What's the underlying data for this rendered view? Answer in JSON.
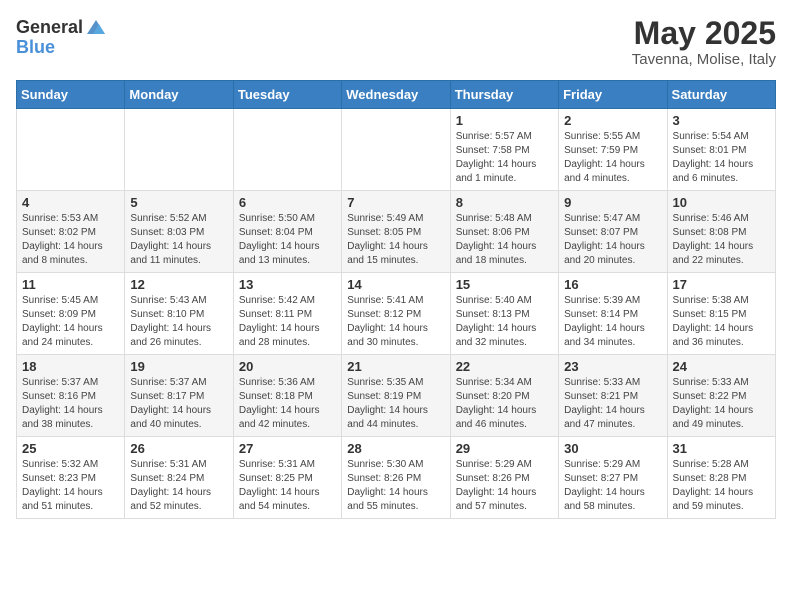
{
  "logo": {
    "general": "General",
    "blue": "Blue"
  },
  "title": "May 2025",
  "subtitle": "Tavenna, Molise, Italy",
  "days_of_week": [
    "Sunday",
    "Monday",
    "Tuesday",
    "Wednesday",
    "Thursday",
    "Friday",
    "Saturday"
  ],
  "weeks": [
    [
      {
        "day": "",
        "info": ""
      },
      {
        "day": "",
        "info": ""
      },
      {
        "day": "",
        "info": ""
      },
      {
        "day": "",
        "info": ""
      },
      {
        "day": "1",
        "info": "Sunrise: 5:57 AM\nSunset: 7:58 PM\nDaylight: 14 hours and 1 minute."
      },
      {
        "day": "2",
        "info": "Sunrise: 5:55 AM\nSunset: 7:59 PM\nDaylight: 14 hours and 4 minutes."
      },
      {
        "day": "3",
        "info": "Sunrise: 5:54 AM\nSunset: 8:01 PM\nDaylight: 14 hours and 6 minutes."
      }
    ],
    [
      {
        "day": "4",
        "info": "Sunrise: 5:53 AM\nSunset: 8:02 PM\nDaylight: 14 hours and 8 minutes."
      },
      {
        "day": "5",
        "info": "Sunrise: 5:52 AM\nSunset: 8:03 PM\nDaylight: 14 hours and 11 minutes."
      },
      {
        "day": "6",
        "info": "Sunrise: 5:50 AM\nSunset: 8:04 PM\nDaylight: 14 hours and 13 minutes."
      },
      {
        "day": "7",
        "info": "Sunrise: 5:49 AM\nSunset: 8:05 PM\nDaylight: 14 hours and 15 minutes."
      },
      {
        "day": "8",
        "info": "Sunrise: 5:48 AM\nSunset: 8:06 PM\nDaylight: 14 hours and 18 minutes."
      },
      {
        "day": "9",
        "info": "Sunrise: 5:47 AM\nSunset: 8:07 PM\nDaylight: 14 hours and 20 minutes."
      },
      {
        "day": "10",
        "info": "Sunrise: 5:46 AM\nSunset: 8:08 PM\nDaylight: 14 hours and 22 minutes."
      }
    ],
    [
      {
        "day": "11",
        "info": "Sunrise: 5:45 AM\nSunset: 8:09 PM\nDaylight: 14 hours and 24 minutes."
      },
      {
        "day": "12",
        "info": "Sunrise: 5:43 AM\nSunset: 8:10 PM\nDaylight: 14 hours and 26 minutes."
      },
      {
        "day": "13",
        "info": "Sunrise: 5:42 AM\nSunset: 8:11 PM\nDaylight: 14 hours and 28 minutes."
      },
      {
        "day": "14",
        "info": "Sunrise: 5:41 AM\nSunset: 8:12 PM\nDaylight: 14 hours and 30 minutes."
      },
      {
        "day": "15",
        "info": "Sunrise: 5:40 AM\nSunset: 8:13 PM\nDaylight: 14 hours and 32 minutes."
      },
      {
        "day": "16",
        "info": "Sunrise: 5:39 AM\nSunset: 8:14 PM\nDaylight: 14 hours and 34 minutes."
      },
      {
        "day": "17",
        "info": "Sunrise: 5:38 AM\nSunset: 8:15 PM\nDaylight: 14 hours and 36 minutes."
      }
    ],
    [
      {
        "day": "18",
        "info": "Sunrise: 5:37 AM\nSunset: 8:16 PM\nDaylight: 14 hours and 38 minutes."
      },
      {
        "day": "19",
        "info": "Sunrise: 5:37 AM\nSunset: 8:17 PM\nDaylight: 14 hours and 40 minutes."
      },
      {
        "day": "20",
        "info": "Sunrise: 5:36 AM\nSunset: 8:18 PM\nDaylight: 14 hours and 42 minutes."
      },
      {
        "day": "21",
        "info": "Sunrise: 5:35 AM\nSunset: 8:19 PM\nDaylight: 14 hours and 44 minutes."
      },
      {
        "day": "22",
        "info": "Sunrise: 5:34 AM\nSunset: 8:20 PM\nDaylight: 14 hours and 46 minutes."
      },
      {
        "day": "23",
        "info": "Sunrise: 5:33 AM\nSunset: 8:21 PM\nDaylight: 14 hours and 47 minutes."
      },
      {
        "day": "24",
        "info": "Sunrise: 5:33 AM\nSunset: 8:22 PM\nDaylight: 14 hours and 49 minutes."
      }
    ],
    [
      {
        "day": "25",
        "info": "Sunrise: 5:32 AM\nSunset: 8:23 PM\nDaylight: 14 hours and 51 minutes."
      },
      {
        "day": "26",
        "info": "Sunrise: 5:31 AM\nSunset: 8:24 PM\nDaylight: 14 hours and 52 minutes."
      },
      {
        "day": "27",
        "info": "Sunrise: 5:31 AM\nSunset: 8:25 PM\nDaylight: 14 hours and 54 minutes."
      },
      {
        "day": "28",
        "info": "Sunrise: 5:30 AM\nSunset: 8:26 PM\nDaylight: 14 hours and 55 minutes."
      },
      {
        "day": "29",
        "info": "Sunrise: 5:29 AM\nSunset: 8:26 PM\nDaylight: 14 hours and 57 minutes."
      },
      {
        "day": "30",
        "info": "Sunrise: 5:29 AM\nSunset: 8:27 PM\nDaylight: 14 hours and 58 minutes."
      },
      {
        "day": "31",
        "info": "Sunrise: 5:28 AM\nSunset: 8:28 PM\nDaylight: 14 hours and 59 minutes."
      }
    ]
  ]
}
